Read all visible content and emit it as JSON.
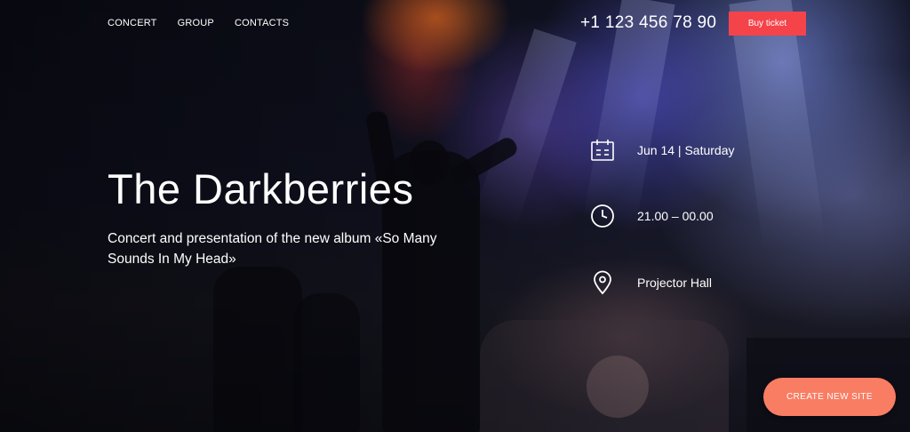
{
  "nav": {
    "items": [
      {
        "label": "CONCERT"
      },
      {
        "label": "GROUP"
      },
      {
        "label": "CONTACTS"
      }
    ]
  },
  "header": {
    "phone": "+1 123 456 78 90",
    "buy_label": "Buy ticket"
  },
  "hero": {
    "title": "The Darkberries",
    "subtitle": "Concert and presentation of the new album «So Many Sounds In My Head»"
  },
  "details": [
    {
      "icon": "calendar-icon",
      "text": "Jun 14 | Saturday"
    },
    {
      "icon": "clock-icon",
      "text": "21.00 – 00.00"
    },
    {
      "icon": "location-pin-icon",
      "text": "Projector Hall"
    }
  ],
  "cta": {
    "label": "CREATE NEW SITE"
  },
  "colors": {
    "accent": "#f5434a",
    "cta": "#f97d63"
  }
}
